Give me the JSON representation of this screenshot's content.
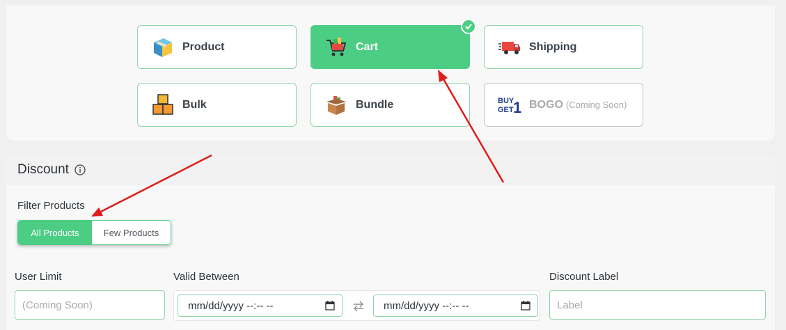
{
  "discount_types": {
    "product": "Product",
    "cart": "Cart",
    "shipping": "Shipping",
    "bulk": "Bulk",
    "bundle": "Bundle",
    "bogo": "BOGO",
    "bogo_note": "(Coming Soon)",
    "bogo_logo": {
      "line1": "BUY",
      "line2": "GET",
      "digit": "1"
    }
  },
  "discount": {
    "title": "Discount",
    "filter_label": "Filter Products",
    "filter_options": [
      "All Products",
      "Few Products"
    ],
    "user_limit_label": "User Limit",
    "user_limit_placeholder": "(Coming Soon)",
    "valid_between_label": "Valid Between",
    "date_start": "mm/dd/yyyy --:-- --",
    "date_end": "mm/dd/yyyy --:-- --",
    "discount_label_label": "Discount Label",
    "discount_label_placeholder": "Label"
  },
  "colors": {
    "accent": "#4ccd84",
    "border": "#8fd4a9",
    "arrow": "#e01b1b"
  }
}
